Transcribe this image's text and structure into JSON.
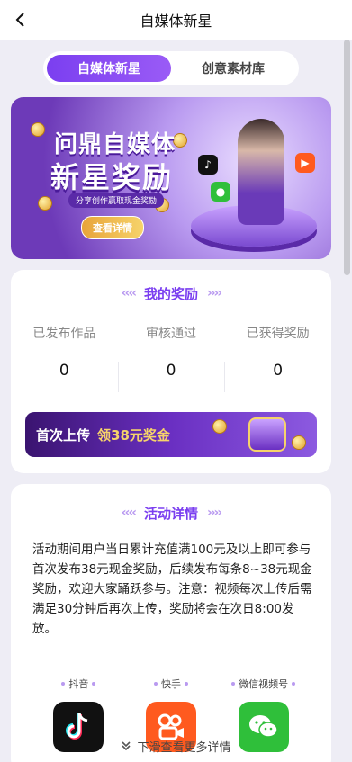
{
  "header": {
    "title": "自媒体新星"
  },
  "tabs": [
    {
      "label": "自媒体新星",
      "active": true
    },
    {
      "label": "创意素材库",
      "active": false
    }
  ],
  "banner": {
    "title_line1": "问鼎自媒体",
    "title_line2": "新星奖励",
    "subtitle": "分享创作赢取现金奖励",
    "button": "查看详情"
  },
  "rewards": {
    "heading": "我的奖励",
    "stats": [
      {
        "label": "已发布作品",
        "value": "0"
      },
      {
        "label": "审核通过",
        "value": "0"
      },
      {
        "label": "已获得奖励",
        "value": "0"
      }
    ],
    "upload_banner": {
      "text1": "首次上传",
      "text2": "领38元奖金"
    }
  },
  "activity": {
    "heading": "活动详情",
    "description": "活动期间用户当日累计充值满100元及以上即可参与\n首次发布38元现金奖励，后续发布每条8~38元现金奖励，欢迎大家踊跃参与。注意：视频每次上传后需满足30分钟后再次上传，奖励将会在次日8:00发放。",
    "platforms": [
      {
        "name": "抖音",
        "icon": "douyin-icon",
        "color": "#111111"
      },
      {
        "name": "快手",
        "icon": "kuaishou-icon",
        "color": "#ff5a1f"
      },
      {
        "name": "微信视频号",
        "icon": "wechat-icon",
        "color": "#2fbf3a"
      }
    ]
  },
  "scroll_hint": "下滑查看更多详情",
  "colors": {
    "accent": "#7b3ff0",
    "background": "#eeedf5"
  }
}
